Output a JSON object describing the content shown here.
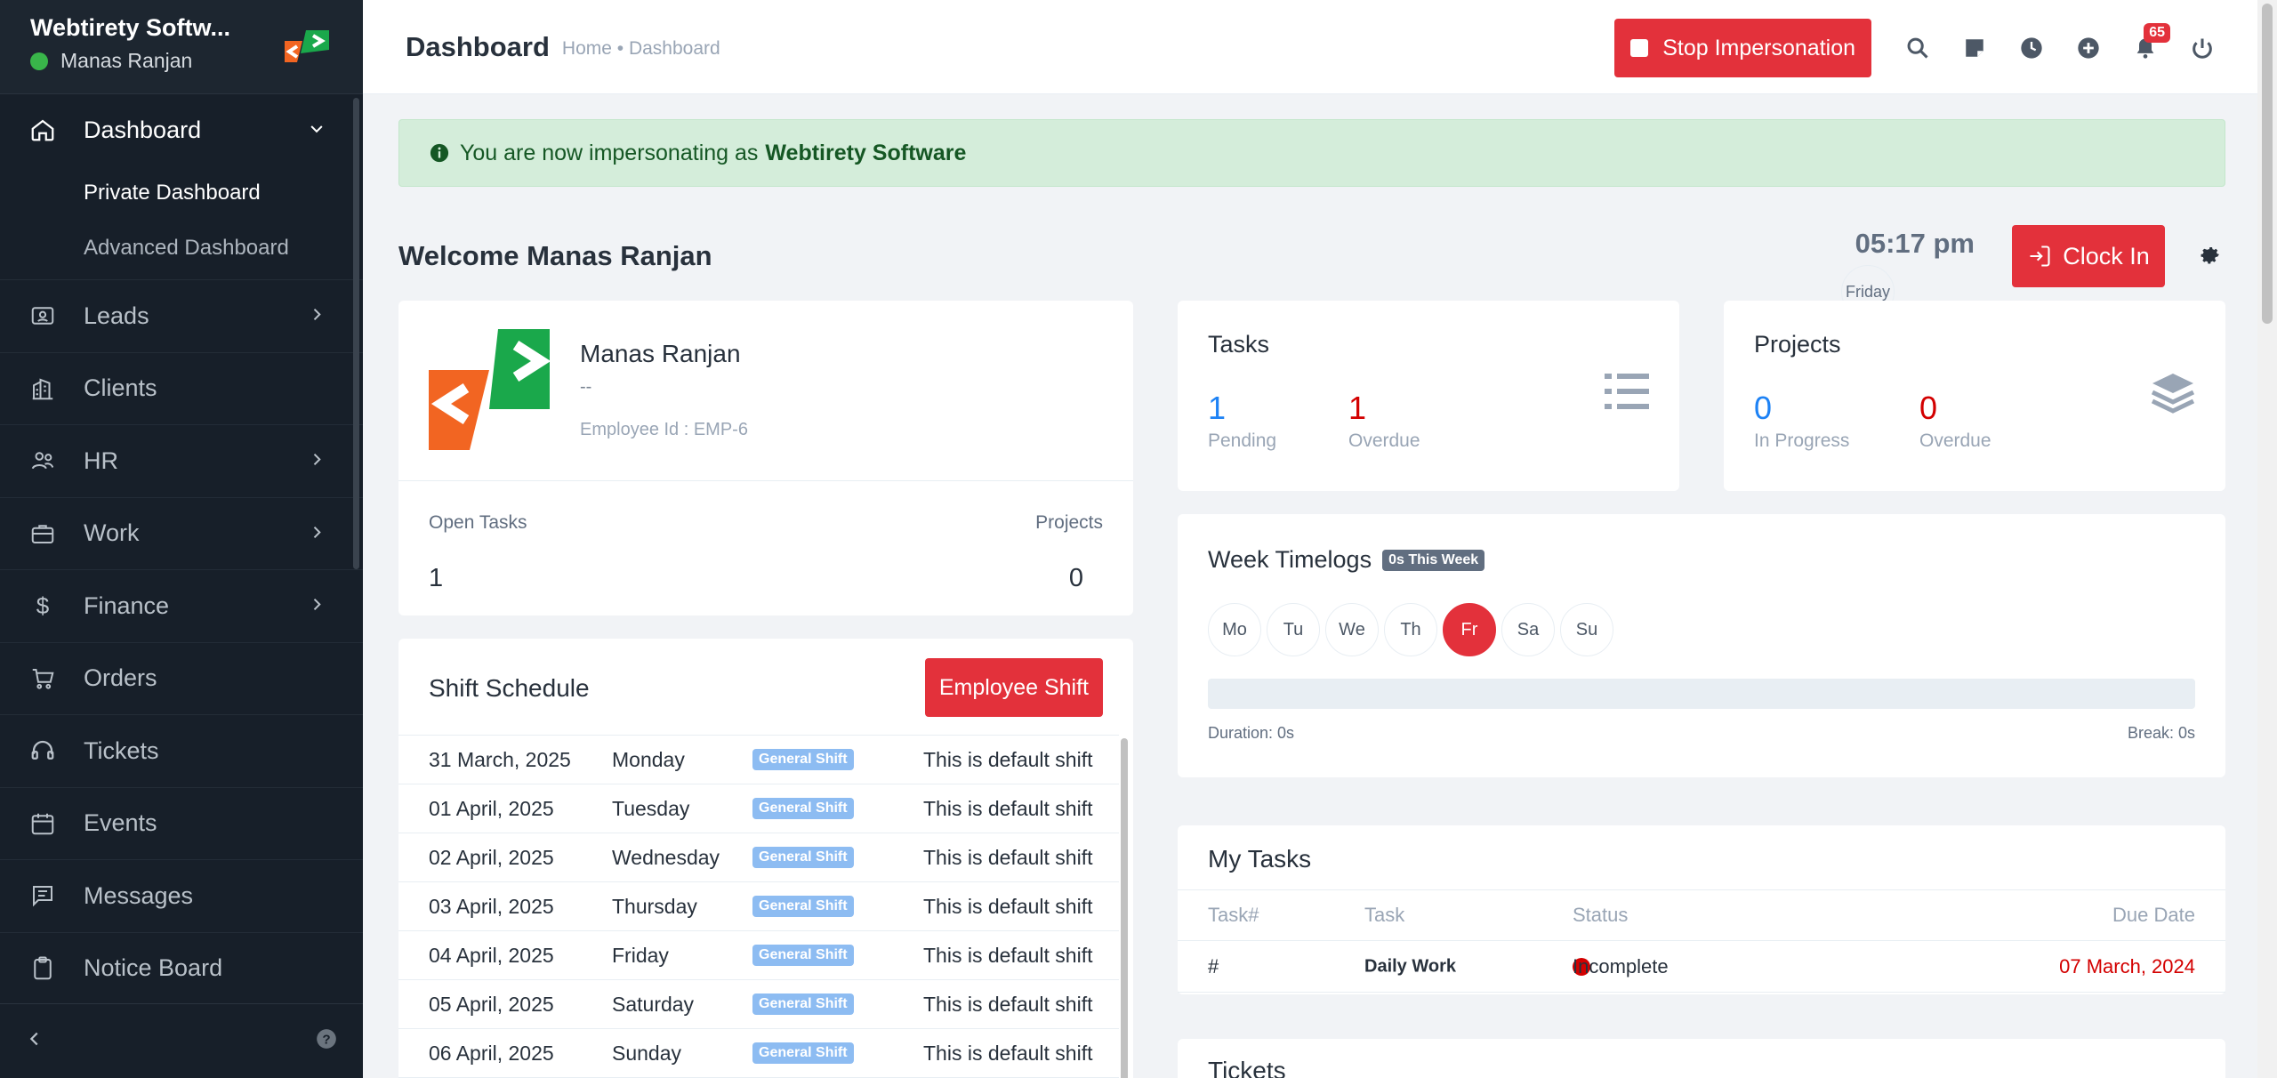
{
  "sidebar": {
    "company": "Webtirety Softw...",
    "user": "Manas Ranjan",
    "items": [
      {
        "label": "Dashboard",
        "icon": "house-icon"
      },
      {
        "label": "Leads",
        "icon": "contact-card-icon"
      },
      {
        "label": "Clients",
        "icon": "building-icon"
      },
      {
        "label": "HR",
        "icon": "people-icon"
      },
      {
        "label": "Work",
        "icon": "briefcase-icon"
      },
      {
        "label": "Finance",
        "icon": "dollar-icon"
      },
      {
        "label": "Orders",
        "icon": "cart-icon"
      },
      {
        "label": "Tickets",
        "icon": "headset-icon"
      },
      {
        "label": "Events",
        "icon": "calendar-icon"
      },
      {
        "label": "Messages",
        "icon": "chat-icon"
      },
      {
        "label": "Notice Board",
        "icon": "clipboard-icon"
      }
    ],
    "sub_items": [
      "Private Dashboard",
      "Advanced Dashboard"
    ]
  },
  "header": {
    "title": "Dashboard",
    "breadcrumb": "Home • Dashboard",
    "stop_label": "Stop Impersonation",
    "notif_count": "65"
  },
  "alert": {
    "text": "You are now impersonating as",
    "company": "Webtirety Software"
  },
  "welcome": "Welcome Manas Ranjan",
  "clock": {
    "time": "05:17 pm",
    "day": "Friday",
    "button": "Clock In"
  },
  "profile": {
    "name": "Manas Ranjan",
    "designation": "--",
    "employee_id": "Employee Id : EMP-6",
    "open_tasks_label": "Open Tasks",
    "open_tasks": "1",
    "projects_label": "Projects",
    "projects": "0"
  },
  "tasks": {
    "title": "Tasks",
    "pending": "1",
    "pending_label": "Pending",
    "overdue": "1",
    "overdue_label": "Overdue"
  },
  "projects": {
    "title": "Projects",
    "in_progress": "0",
    "in_progress_label": "In Progress",
    "overdue": "0",
    "overdue_label": "Overdue"
  },
  "timelogs": {
    "title": "Week Timelogs",
    "badge": "0s This Week",
    "days": [
      "Mo",
      "Tu",
      "We",
      "Th",
      "Fr",
      "Sa",
      "Su"
    ],
    "active_day": "Fr",
    "duration": "Duration: 0s",
    "break": "Break: 0s",
    "progress": 0
  },
  "shift": {
    "title": "Shift Schedule",
    "button": "Employee Shift",
    "rows": [
      {
        "date": "31 March, 2025",
        "day": "Monday",
        "shift": "General Shift",
        "note": "This is default shift"
      },
      {
        "date": "01 April, 2025",
        "day": "Tuesday",
        "shift": "General Shift",
        "note": "This is default shift"
      },
      {
        "date": "02 April, 2025",
        "day": "Wednesday",
        "shift": "General Shift",
        "note": "This is default shift"
      },
      {
        "date": "03 April, 2025",
        "day": "Thursday",
        "shift": "General Shift",
        "note": "This is default shift"
      },
      {
        "date": "04 April, 2025",
        "day": "Friday",
        "shift": "General Shift",
        "note": "This is default shift"
      },
      {
        "date": "05 April, 2025",
        "day": "Saturday",
        "shift": "General Shift",
        "note": "This is default shift"
      },
      {
        "date": "06 April, 2025",
        "day": "Sunday",
        "shift": "General Shift",
        "note": "This is default shift"
      }
    ]
  },
  "my_tasks": {
    "title": "My Tasks",
    "headers": [
      "Task#",
      "Task",
      "Status",
      "Due Date"
    ],
    "row": {
      "num": "#",
      "task": "Daily Work",
      "status": "Incomplete",
      "due": "07 March, 2024"
    }
  },
  "tickets": {
    "title": "Tickets"
  },
  "colors": {
    "accent": "#e3313b",
    "sidebar": "#171f29",
    "link": "#1d82f5",
    "danger": "#d30000",
    "success_bg": "#d4edda"
  }
}
